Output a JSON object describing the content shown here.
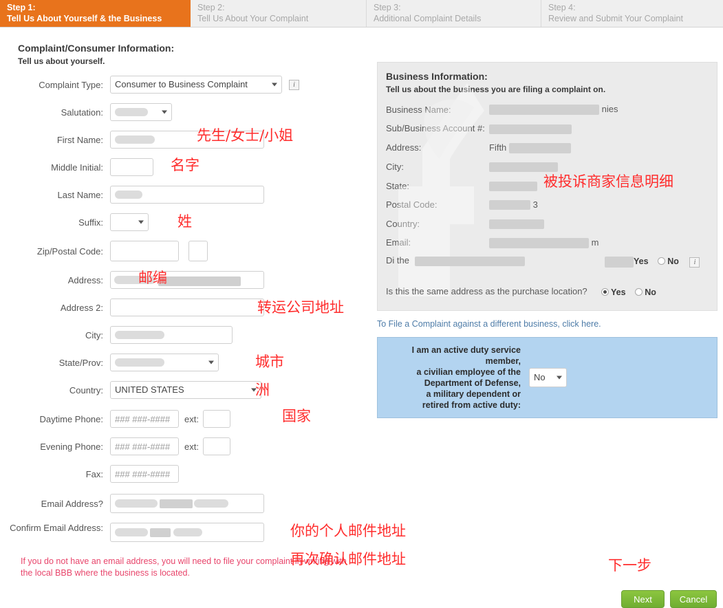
{
  "steps": [
    {
      "num": "Step 1:",
      "label": "Tell Us About Yourself & the Business",
      "active": true
    },
    {
      "num": "Step 2:",
      "label": "Tell Us About Your Complaint",
      "active": false
    },
    {
      "num": "Step 3:",
      "label": "Additional Complaint Details",
      "active": false
    },
    {
      "num": "Step 4:",
      "label": "Review and Submit Your Complaint",
      "active": false
    }
  ],
  "consumer": {
    "title": "Complaint/Consumer Information:",
    "subtitle": "Tell us about yourself.",
    "labels": {
      "complaint_type": "Complaint Type:",
      "salutation": "Salutation:",
      "first_name": "First Name:",
      "middle_initial": "Middle Initial:",
      "last_name": "Last Name:",
      "suffix": "Suffix:",
      "zip": "Zip/Postal Code:",
      "address": "Address:",
      "address2": "Address 2:",
      "city": "City:",
      "state": "State/Prov:",
      "country": "Country:",
      "daytime_phone": "Daytime Phone:",
      "evening_phone": "Evening Phone:",
      "fax": "Fax:",
      "email": "Email Address?",
      "confirm_email": "Confirm Email Address:",
      "ext": "ext:"
    },
    "values": {
      "complaint_type": "Consumer to Business Complaint",
      "salutation": "",
      "first_name": "",
      "middle_initial": "",
      "last_name": "",
      "suffix": "",
      "zip": "",
      "zip_ext": "",
      "address": "",
      "address2": "",
      "city": "",
      "state": "",
      "country": "UNITED STATES",
      "daytime_phone": "",
      "daytime_ext": "",
      "evening_phone": "",
      "evening_ext": "",
      "fax": "",
      "email": "",
      "confirm_email": ""
    },
    "placeholders": {
      "phone": "### ###-####"
    },
    "warning": "If you do not have an email address, you will need to file your complaint in writing with the local BBB where the business is located."
  },
  "business": {
    "title": "Business Information:",
    "subtitle": "Tell us about the business you are filing a complaint on.",
    "fields": [
      {
        "label": "Business Name:",
        "value": "nies"
      },
      {
        "label": "Sub/Business Account #:",
        "value": ""
      },
      {
        "label": "Address:",
        "value": "Fifth"
      },
      {
        "label": "City:",
        "value": ""
      },
      {
        "label": "State:",
        "value": ""
      },
      {
        "label": "Postal Code:",
        "value": "3"
      },
      {
        "label": "Country:",
        "value": ""
      },
      {
        "label": "Email:",
        "value": "m"
      }
    ],
    "question_partial": "Di                 the",
    "partial_yes": "Yes",
    "partial_no": "No",
    "same_address_question": "Is this the same address as the purchase location?",
    "same_address_yes": "Yes",
    "same_address_no": "No",
    "same_address_selected": "Yes",
    "different_business_link": "To File a Complaint against a different business, click here."
  },
  "military": {
    "text": "I am an active duty service member,\na civilian employee of the Department of Defense,\na military dependent or retired from active duty:",
    "line1": "I am an active duty service",
    "line2": "member,",
    "line3": "a civilian employee of the",
    "line4": "Department of Defense,",
    "line5": "a military dependent or",
    "line6": "retired from active duty:",
    "value": "No"
  },
  "footer": {
    "next": "Next",
    "cancel": "Cancel"
  },
  "annotations": {
    "salutation": "先生/女士/小姐",
    "first_name": "名字",
    "last_name": "姓",
    "zip": "邮编",
    "address": "转运公司地址",
    "city": "城市",
    "state": "洲",
    "country": "国家",
    "business_detail": "被投诉商家信息明细",
    "email": "你的个人邮件地址",
    "confirm_email": "再次确认邮件地址",
    "next": "下一步"
  },
  "colors": {
    "active_step": "#e8731c",
    "button_green": "#7ab84a",
    "annotation_red": "#ff2d2d",
    "link_blue": "#4e7ca8",
    "warning_pink": "#e8456b",
    "military_panel": "#b3d4f0",
    "business_panel": "#ebebeb"
  }
}
